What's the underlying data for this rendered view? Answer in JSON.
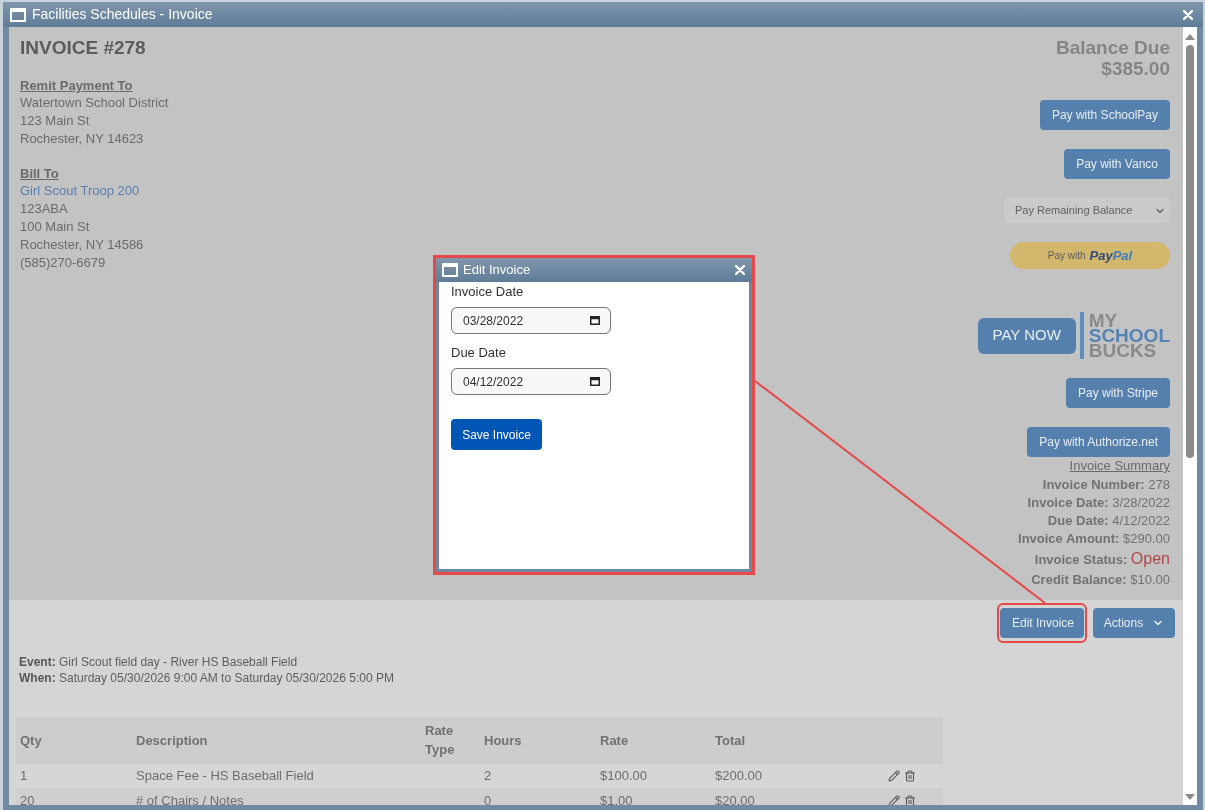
{
  "window": {
    "title": "Facilities Schedules - Invoice"
  },
  "invoice": {
    "heading": "INVOICE #278",
    "remit_to": {
      "heading": "Remit Payment To",
      "lines": [
        "Watertown School District",
        "123 Main St",
        "Rochester, NY 14623"
      ]
    },
    "bill_to": {
      "heading": "Bill To",
      "name": "Girl Scout Troop 200",
      "lines": [
        "123ABA",
        "100 Main St",
        "Rochester, NY 14586",
        "(585)270-6679"
      ]
    },
    "balance_due": {
      "label": "Balance Due",
      "amount": "$385.00"
    },
    "payment_options": [
      {
        "kind": "button",
        "label": "Pay with SchoolPay"
      },
      {
        "kind": "button",
        "label": "Pay with Vanco"
      },
      {
        "kind": "select",
        "value": "Pay Remaining Balance"
      },
      {
        "kind": "paypal",
        "label": "Pay with",
        "brand": [
          "Pay",
          "Pal"
        ]
      },
      {
        "kind": "myschoolbucks",
        "label": "PAY NOW",
        "logo": [
          "MY",
          "SCHOOL",
          "BUCKS"
        ]
      },
      {
        "kind": "button",
        "label": "Pay with Stripe"
      },
      {
        "kind": "button",
        "label": "Pay with Authorize.net"
      }
    ],
    "summary": {
      "heading": "Invoice Summary",
      "items": [
        {
          "kind": "field",
          "label": "Invoice Number:",
          "value": "278"
        },
        {
          "kind": "field",
          "label": "Invoice Date:",
          "value": "3/28/2022"
        },
        {
          "kind": "field",
          "label": "Due Date:",
          "value": "4/12/2022"
        },
        {
          "kind": "field",
          "label": "Invoice Amount:",
          "value": "$290.00"
        },
        {
          "kind": "status",
          "label": "Invoice Status:",
          "value": "Open"
        },
        {
          "kind": "field",
          "label": "Credit Balance:",
          "value": "$10.00"
        }
      ]
    }
  },
  "toolbar": {
    "buttons": [
      {
        "kind": "button",
        "label": "Edit Invoice",
        "highlighted": true
      },
      {
        "kind": "dropdown",
        "label": "Actions",
        "highlighted": false
      }
    ]
  },
  "event": [
    {
      "label": "Event:",
      "value": "Girl Scout field day - River HS Baseball Field"
    },
    {
      "label": "When:",
      "value": "Saturday 05/30/2026 9:00 AM to Saturday 05/30/2026 5:00 PM"
    }
  ],
  "table": {
    "columns": [
      "Qty",
      "Description",
      "Rate Type",
      "Hours",
      "Rate",
      "Total"
    ],
    "rows": [
      {
        "qty": "1",
        "description": "Space Fee - HS Baseball Field",
        "hours": "2",
        "rate": "$100.00",
        "total": "$200.00"
      },
      {
        "qty": "20",
        "description": "# of Chairs / Notes",
        "hours": "0",
        "rate": "$1.00",
        "total": "$20.00"
      }
    ]
  },
  "dialog": {
    "title": "Edit Invoice",
    "highlighted": true,
    "fields": [
      {
        "label": "Invoice Date",
        "value": "03/28/2022"
      },
      {
        "label": "Due Date",
        "value": "04/12/2022"
      }
    ],
    "submit": "Save Invoice"
  }
}
